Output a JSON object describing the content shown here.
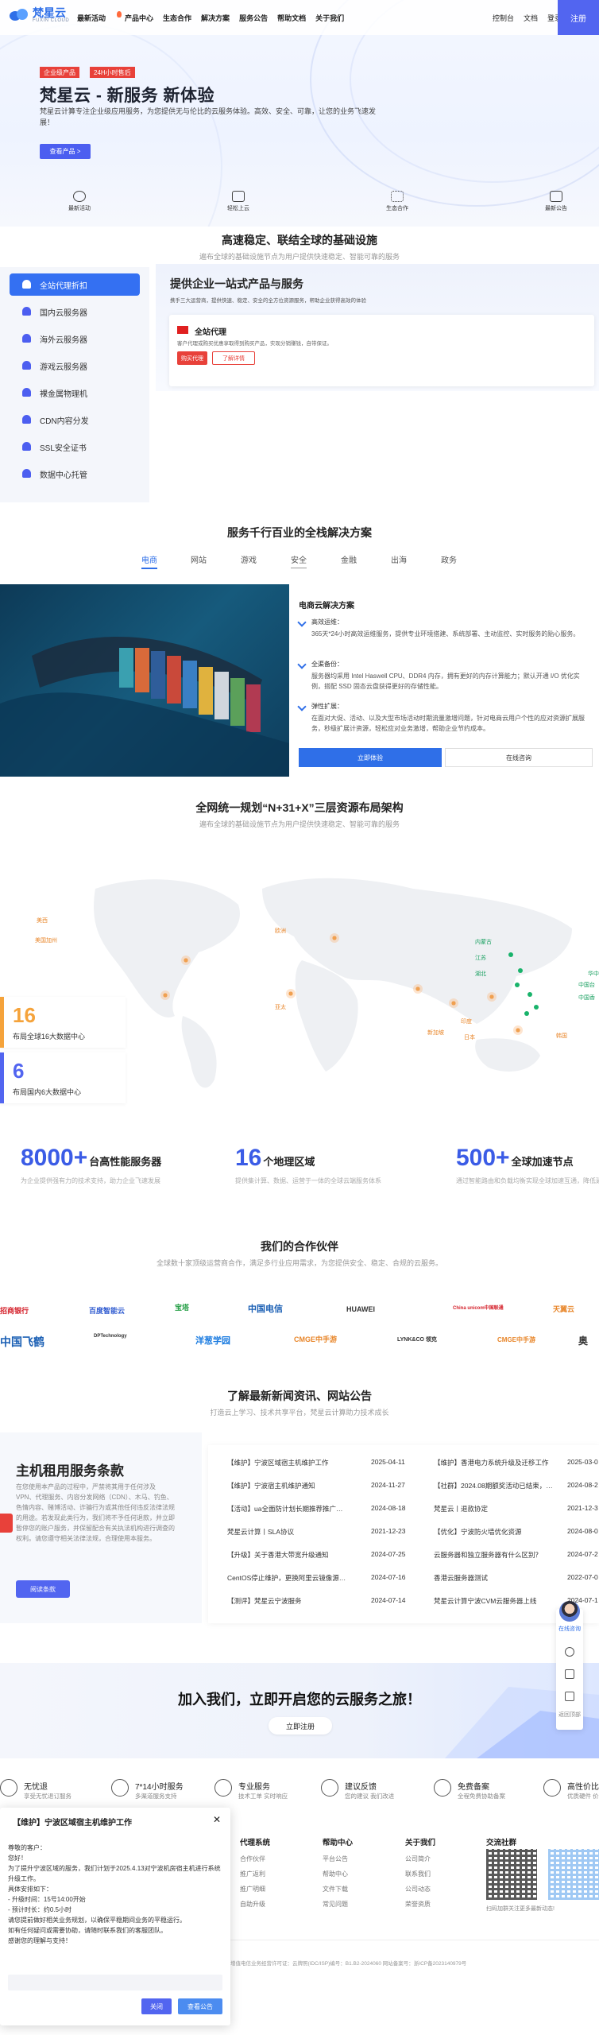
{
  "header": {
    "logo_name": "梵星云",
    "logo_sub": "FUXIN CLOUD",
    "nav": [
      "最新活动",
      "产品中心",
      "生态合作",
      "解决方案",
      "服务公告",
      "帮助文档",
      "关于我们"
    ],
    "right_nav": [
      "控制台",
      "文档",
      "登录"
    ],
    "register": "注册"
  },
  "hero": {
    "badge1": "企业级产品",
    "badge2": "24H小时售后",
    "title": "梵星云 - 新服务 新体验",
    "desc": "梵星云计算专注企业级应用服务，为您提供无与伦比的云服务体验。高效、安全、可靠，让您的业务飞速发展！",
    "cta": "查看产品 >",
    "quick": [
      "最新活动",
      "轻松上云",
      "生态合作",
      "最新公告"
    ]
  },
  "infra": {
    "title": "高速稳定、联结全球的基础设施",
    "subtitle": "遍布全球的基础设施节点为用户提供快速稳定、智能可靠的服务",
    "menu": [
      "全站代理折扣",
      "国内云服务器",
      "海外云服务器",
      "游戏云服务器",
      "裸金属物理机",
      "CDN内容分发",
      "SSL安全证书",
      "数据中心托管"
    ],
    "panel_title": "提供企业一站式产品与服务",
    "panel_desc": "携手三大运营商，提供快速、稳定、安全的全方位资源服务，帮助企业获得高效的体验",
    "card_title": "全站代理",
    "card_desc": "客户代理或购买优惠享取得到购买产品，实现分销赚钱，自带保证。",
    "btn1": "购买代理",
    "btn2": "了解详情"
  },
  "solutions": {
    "title": "服务千行百业的全栈解决方案",
    "tabs": [
      "电商",
      "网站",
      "游戏",
      "安全",
      "金融",
      "出海",
      "政务"
    ],
    "active_tab": 0,
    "panel_title": "电商云解决方案",
    "features": [
      {
        "h": "高效运维：",
        "b": "365天*24小时高效运维服务，提供专业环境搭建、系统部署、主动监控、实时服务的贴心服务。"
      },
      {
        "h": "全渠备份：",
        "b": "服务器均采用 Intel Haswell CPU、DDR4 内存，拥有更好的内存计算能力；默认开通 I/O 优化实例，搭配 SSD 固态云盘获得更好的存储性能。"
      },
      {
        "h": "弹性扩展：",
        "b": "在面对大促、活动、以及大型市场活动时期流量激增问题，针对电商云用户个性的应对资源扩展服务，秒级扩展计资源，轻松应对业务激增，帮助企业节约成本。"
      }
    ],
    "btn1": "立即体验",
    "btn2": "在线咨询"
  },
  "map": {
    "title": "全网统一规划“N+31+X”三层资源布局架构",
    "subtitle": "遍布全球的基础设施节点为用户提供快速稳定、智能可靠的服务",
    "labels_orange": [
      "美西",
      "美国加州",
      "欧洲",
      "亚太",
      "新加坡",
      "印度",
      "日本",
      "韩国"
    ],
    "labels_green": [
      "内蒙古",
      "江苏",
      "湖北",
      "华中",
      "中国台",
      "中国香"
    ],
    "stat1": {
      "n": "16",
      "l": "布局全球16大数据中心"
    },
    "stat2": {
      "n": "6",
      "l": "布局国内6大数据中心"
    },
    "stat_colors": [
      "#f5a33b",
      "#5265f0"
    ]
  },
  "stats": [
    {
      "n": "8000+",
      "u": "台高性能服务器",
      "d": "为企业提供强有力的技术支持，助力企业飞速发展"
    },
    {
      "n": "16",
      "u": "个地理区域",
      "d": "提供集计算、数据、运营于一体的全球云端服务体系"
    },
    {
      "n": "500+",
      "u": "全球加速节点",
      "d": "通过智能路由和负载均衡实现全球加速互通，降低延迟"
    }
  ],
  "partners": {
    "title": "我们的合作伙伴",
    "subtitle": "全球数十家顶级运营商合作，满足多行业应用需求，为您提供安全、稳定、合规的云服务。",
    "row1": [
      "招商银行",
      "百度智能云",
      "宝塔",
      "中国电信",
      "HUAWEI",
      "China unicom中国联通",
      "天翼云"
    ],
    "row2": [
      "中国飞鹤",
      "DPTechnology",
      "洋葱学园",
      "CMGE中手游",
      "LYNK&CO 领克",
      "CMGE中手游",
      "奥"
    ]
  },
  "news": {
    "title": "了解最新新闻资讯、网站公告",
    "subtitle": "打造云上学习、技术共享平台，梵星云计算助力技术成长",
    "feature_title": "主机租用服务条款",
    "feature_desc": "在您使用本产品的过程中，严禁将其用于任何涉及VPN、代理服务、内容分发网络（CDN）、木马、钓鱼、色情内容、赌博活动、诈骗行为或其他任何违反法律法规的用途。若发现此类行为，我们将不予任何退款，并立即暂停您的账户服务，并保留配合有关执法机构进行调查的权利。请您遵守相关法律法规，合理使用本服务。",
    "feature_btn": "阅读条款",
    "col1": [
      {
        "t": "【维护】宁波区域宿主机维护工作",
        "d": "2025-04-11"
      },
      {
        "t": "【维护】宁波宿主机维护通知",
        "d": "2024-11-27"
      },
      {
        "t": "【活动】ua全面防计划长期推荐推广…",
        "d": "2024-08-18"
      },
      {
        "t": "梵星云计算丨SLA协议",
        "d": "2021-12-23"
      },
      {
        "t": "【升级】关于香港大带宽升级通知",
        "d": "2024-07-25"
      },
      {
        "t": "CentOS停止维护，更换阿里云镜像源…",
        "d": "2024-07-16"
      },
      {
        "t": "【测评】梵星云宁波服务",
        "d": "2024-07-14"
      }
    ],
    "col2": [
      {
        "t": "【维护】香港电力系统升级及迁移工作",
        "d": "2025-03-0"
      },
      {
        "t": "【社群】2024.08期额奖活动已结束，…",
        "d": "2024-08-2"
      },
      {
        "t": "梵星云丨退款协定",
        "d": "2021-12-3"
      },
      {
        "t": "【优化】宁波防火墙优化资源",
        "d": "2024-08-0"
      },
      {
        "t": "云服务器和独立服务器有什么区别？",
        "d": "2024-07-2"
      },
      {
        "t": "香港云服务器测试",
        "d": "2022-07-0"
      },
      {
        "t": "梵星云计算宁波CVM云服务器上线",
        "d": "2024-07-1"
      }
    ]
  },
  "join": {
    "title": "加入我们，立即开启您的云服务之旅！",
    "btn": "立即注册"
  },
  "features": [
    {
      "t": "无忧退",
      "s": "享受无忧退订服务"
    },
    {
      "t": "7*14小时服务",
      "s": "多渠道服务支持"
    },
    {
      "t": "专业服务",
      "s": "技术工单 实时响应"
    },
    {
      "t": "建议反馈",
      "s": "您的建议 我们改进"
    },
    {
      "t": "免费备案",
      "s": "全程免费协助备案"
    },
    {
      "t": "高性价比",
      "s": "优质硬件 价格实惠"
    }
  ],
  "footer": {
    "cols": [
      {
        "h": "代理系统",
        "items": [
          "合作伙伴",
          "推广返利",
          "推广明细",
          "自助升级"
        ]
      },
      {
        "h": "帮助中心",
        "items": [
          "平台公告",
          "帮助中心",
          "文件下载",
          "常见问题"
        ]
      },
      {
        "h": "关于我们",
        "items": [
          "公司简介",
          "联系我们",
          "公司动态",
          "荣誉资质"
        ]
      }
    ],
    "qr_title": "交流社群",
    "qr_caption": "扫码加群关注更多最新动态!",
    "icp": "增值电信业务经营许可证：云牌照(IDC/ISP)编号：B1.B2-2024060 网站备案号：浙ICP备2023140979号"
  },
  "popup": {
    "title": "【维护】宁波区域宿主机维护工作",
    "body": "尊敬的客户：\n您好！\n为了提升宁波区域的服务，我们计划于2025.4.13对宁波机房宿主机进行系统升级工作。\n具体安排如下：\n- 升级时间：15号14:00开始\n- 预计时长：约0.5小时\n请您提前做好相关业务规划，以确保平稳期间业务的平稳运行。\n如有任何疑问或需要协助，请随时联系我们的客服团队。\n感谢您的理解与支持！",
    "close": "关闭",
    "view": "查看公告"
  },
  "float": {
    "consult": "在线咨询",
    "top": "返回顶部"
  }
}
